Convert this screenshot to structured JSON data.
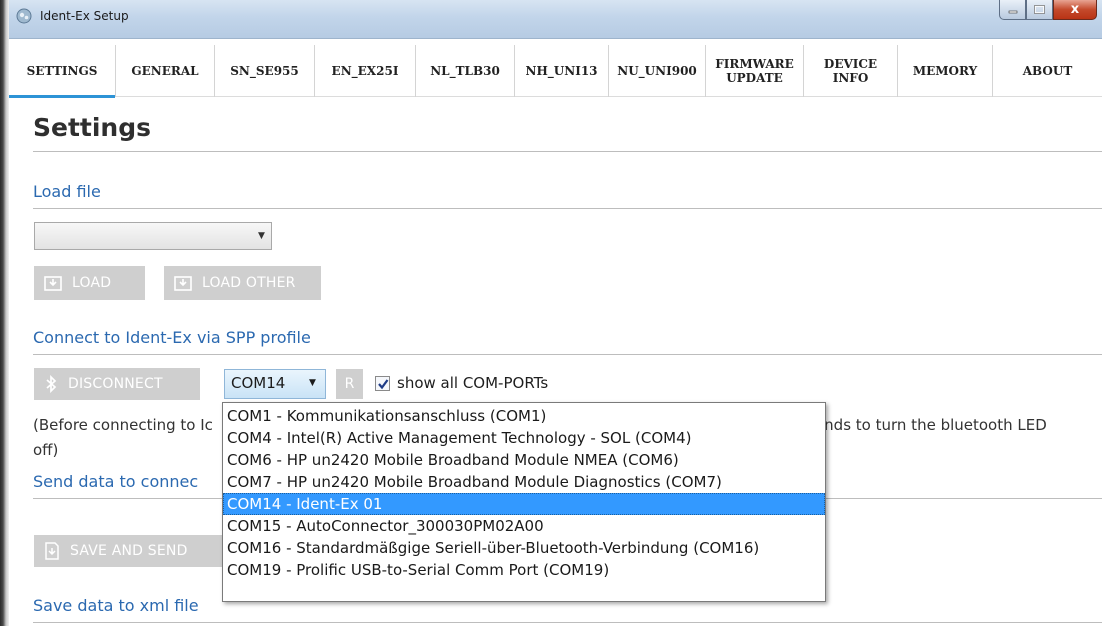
{
  "window": {
    "title": "Ident-Ex Setup",
    "controls": {
      "minimize": "–",
      "maximize": "□",
      "close": "x"
    }
  },
  "tabs": [
    {
      "label": "SETTINGS",
      "active": true
    },
    {
      "label": "GENERAL"
    },
    {
      "label": "SN_SE955"
    },
    {
      "label": "EN_EX25I"
    },
    {
      "label": "NL_TLB30"
    },
    {
      "label": "NH_UNI13"
    },
    {
      "label": "NU_UNI900"
    },
    {
      "label": "FIRMWARE\nUPDATE"
    },
    {
      "label": "DEVICE\nINFO"
    },
    {
      "label": "MEMORY"
    },
    {
      "label": "ABOUT"
    }
  ],
  "page": {
    "title": "Settings",
    "load_section": {
      "heading": "Load file",
      "file_select_value": "",
      "load_button": "LOAD",
      "load_other_button": "LOAD OTHER"
    },
    "connect_section": {
      "heading": "Connect to Ident-Ex via SPP profile",
      "disconnect_button": "DISCONNECT",
      "com_port_value": "COM14",
      "refresh_button": "R",
      "show_all_checked": true,
      "show_all_label": "show all COM-PORTs",
      "hint_left_line1": "(Before connecting to Ic",
      "hint_right_line1": "onds to turn the bluetooth LED",
      "hint_line2": "off)"
    },
    "send_section": {
      "heading": "Send data to connec",
      "save_send_button": "SAVE AND SEND"
    },
    "xml_section": {
      "heading": "Save data to xml file"
    }
  },
  "com_dropdown": {
    "options": [
      "COM1 - Kommunikationsanschluss (COM1)",
      "COM4 - Intel(R) Active Management Technology - SOL (COM4)",
      "COM6 - HP un2420 Mobile Broadband Module NMEA (COM6)",
      "COM7 - HP un2420 Mobile Broadband Module Diagnostics (COM7)",
      "COM14 - Ident-Ex 01",
      "COM15 - AutoConnector_300030PM02A00",
      "COM16 - Standardmäßgige Seriell-über-Bluetooth-Verbindung (COM16)",
      "COM19 - Prolific USB-to-Serial Comm Port (COM19)"
    ],
    "selected_index": 4
  },
  "colors": {
    "accent_tab": "#2d93d6",
    "link": "#2b69b0",
    "flat_button": "#cfcfcf",
    "selection": "#3399ff"
  }
}
